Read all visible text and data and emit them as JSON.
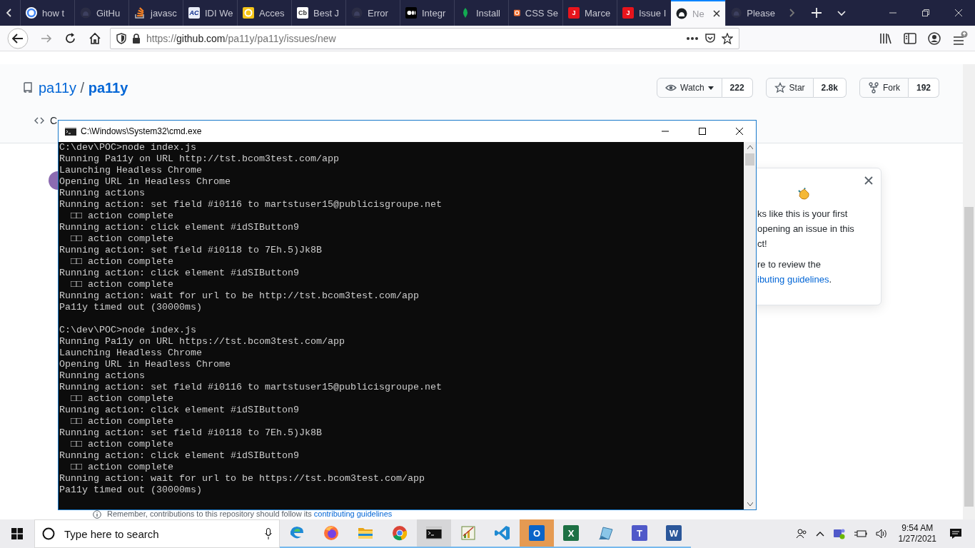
{
  "browser": {
    "tabs": [
      {
        "label": "how t",
        "selected": false,
        "favicon": {
          "kind": "circle",
          "color": "#4285f4"
        }
      },
      {
        "label": "GitHu",
        "selected": false,
        "favicon": {
          "kind": "github",
          "color": "#2b2d45"
        }
      },
      {
        "label": "javasc",
        "selected": false,
        "favicon": {
          "kind": "stack",
          "color": "#f48024"
        }
      },
      {
        "label": "IDI We",
        "selected": false,
        "favicon": {
          "kind": "letter",
          "color": "#0a2a8a",
          "text": "AC"
        }
      },
      {
        "label": "Acces",
        "selected": false,
        "favicon": {
          "kind": "ring",
          "color": "#f5c518"
        }
      },
      {
        "label": "Best J",
        "selected": false,
        "favicon": {
          "kind": "box",
          "color": "#ffffff",
          "text": "Cb"
        }
      },
      {
        "label": "Error",
        "selected": false,
        "favicon": {
          "kind": "github",
          "color": "#2b2d45"
        }
      },
      {
        "label": "Integr",
        "selected": false,
        "favicon": {
          "kind": "dots",
          "color": "#000000"
        }
      },
      {
        "label": "Install",
        "selected": false,
        "favicon": {
          "kind": "leaf",
          "color": "#13aa52"
        }
      },
      {
        "label": "CSS Se",
        "selected": false,
        "favicon": {
          "kind": "ring",
          "color": "#f07030"
        }
      },
      {
        "label": "Marce",
        "selected": false,
        "favicon": {
          "kind": "box",
          "color": "#e8141c",
          "text": "J"
        }
      },
      {
        "label": "Issue I",
        "selected": false,
        "favicon": {
          "kind": "box",
          "color": "#e8141c",
          "text": "J"
        }
      },
      {
        "label": "Ne",
        "selected": true,
        "favicon": {
          "kind": "github",
          "color": "#1b1f23"
        }
      },
      {
        "label": "Please",
        "selected": false,
        "favicon": {
          "kind": "github",
          "color": "#2b2d45"
        }
      }
    ],
    "url": {
      "host_prefix": "https://",
      "host": "github.com",
      "path": "/pa11y/pa11y/issues/new"
    }
  },
  "repo": {
    "owner": "pa11y",
    "separator": "/",
    "name": "pa11y",
    "actions": [
      {
        "kind": "watch",
        "label": "Watch",
        "count": "222"
      },
      {
        "kind": "star",
        "label": "Star",
        "count": "2.8k"
      },
      {
        "kind": "fork",
        "label": "Fork",
        "count": "192"
      }
    ],
    "tab_fragment": "C"
  },
  "popup": {
    "lines": [
      "ks like this is your first",
      "opening an issue in this",
      "ct!"
    ],
    "review": "re to review the",
    "link": "ibuting guidelines",
    "link_end": "."
  },
  "footer_note": {
    "text": "Remember, contributions to this repository should follow its ",
    "link": "contributing guidelines"
  },
  "console": {
    "title": "C:\\Windows\\System32\\cmd.exe",
    "runs": [
      [
        "C:\\dev\\POC>node index.js",
        "Running Pa11y on URL http://tst.bcom3test.com/app",
        "Launching Headless Chrome",
        "Opening URL in Headless Chrome",
        "Running actions",
        "Running action: set field #i0116 to martstuser15@publicisgroupe.net",
        "  □□ action complete",
        "Running action: click element #idSIButton9",
        "  □□ action complete",
        "Running action: set field #i0118 to 7Eh.5)Jk8B",
        "  □□ action complete",
        "Running action: click element #idSIButton9",
        "  □□ action complete",
        "Running action: wait for url to be http://tst.bcom3test.com/app",
        "Pa11y timed out (30000ms)"
      ],
      [
        "C:\\dev\\POC>node index.js",
        "Running Pa11y on URL https://tst.bcom3test.com/app",
        "Launching Headless Chrome",
        "Opening URL in Headless Chrome",
        "Running actions",
        "Running action: set field #i0116 to martstuser15@publicisgroupe.net",
        "  □□ action complete",
        "Running action: click element #idSIButton9",
        "  □□ action complete",
        "Running action: set field #i0118 to 7Eh.5)Jk8B",
        "  □□ action complete",
        "Running action: click element #idSIButton9",
        "  □□ action complete",
        "Running action: wait for url to be https://tst.bcom3test.com/app",
        "Pa11y timed out (30000ms)"
      ]
    ]
  },
  "taskbar": {
    "search_placeholder": "Type here to search",
    "apps": [
      {
        "kind": "edge",
        "running": true,
        "active": false
      },
      {
        "kind": "firefox",
        "running": true,
        "active": false
      },
      {
        "kind": "folder",
        "running": true,
        "active": false
      },
      {
        "kind": "chrome",
        "running": true,
        "active": false
      },
      {
        "kind": "terminal",
        "running": true,
        "active": true
      },
      {
        "kind": "chart",
        "running": true,
        "active": false
      },
      {
        "kind": "code",
        "running": true,
        "active": false
      },
      {
        "kind": "letter",
        "text": "O",
        "color": "#0a64c8",
        "running": true,
        "active": false,
        "flashing": true
      },
      {
        "kind": "letter",
        "text": "X",
        "color": "#1d7044",
        "running": true,
        "active": false
      },
      {
        "kind": "sheet",
        "running": true,
        "active": false
      },
      {
        "kind": "letter",
        "text": "T",
        "color": "#5059c9",
        "running": true,
        "active": false
      },
      {
        "kind": "letter",
        "text": "W",
        "color": "#2b579a",
        "running": true,
        "active": false
      }
    ],
    "time": "9:54 AM",
    "date": "1/27/2021"
  }
}
